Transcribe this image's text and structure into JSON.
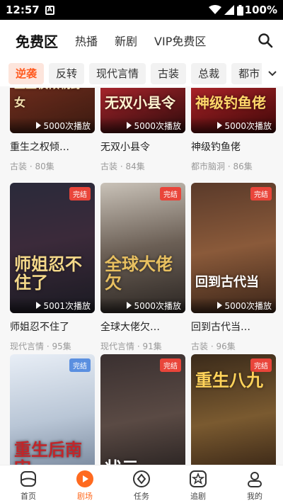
{
  "status": {
    "time": "12:57",
    "battery": "100%"
  },
  "header": {
    "tabs": [
      {
        "label": "免费区",
        "active": true
      },
      {
        "label": "热播"
      },
      {
        "label": "新剧"
      },
      {
        "label": "VIP免费区"
      }
    ]
  },
  "categories": [
    "逆袭",
    "反转",
    "现代言情",
    "古装",
    "总裁",
    "都市"
  ],
  "cards": [
    {
      "title": "重生之权倾…",
      "meta": "古装 · 80集",
      "plays": "5000次播放",
      "art": "重生权倾朝野女",
      "badge": ""
    },
    {
      "title": "无双小县令",
      "meta": "古装 · 84集",
      "plays": "5000次播放",
      "art": "无双小县令",
      "badge": ""
    },
    {
      "title": "神级钓鱼佬",
      "meta": "都市脑洞 · 86集",
      "plays": "5000次播放",
      "art": "神级钓鱼佬",
      "badge": ""
    },
    {
      "title": "师姐忍不住了",
      "meta": "现代言情 · 95集",
      "plays": "5001次播放",
      "art": "师姐忍不住了",
      "badge": "完结"
    },
    {
      "title": "全球大佬欠…",
      "meta": "现代言情 · 91集",
      "plays": "5000次播放",
      "art": "全球大佬欠",
      "badge": "完结"
    },
    {
      "title": "回到古代当…",
      "meta": "古装 · 96集",
      "plays": "5000次播放",
      "art": "回到古代当",
      "badge": "完结"
    },
    {
      "title": "",
      "meta": "",
      "plays": "",
      "art": "重生后南宋",
      "badge": "完结"
    },
    {
      "title": "",
      "meta": "",
      "plays": "",
      "art": "状元",
      "badge": "完结"
    },
    {
      "title": "",
      "meta": "",
      "plays": "",
      "art": "重生八九",
      "badge": "完结"
    }
  ],
  "tabbar": [
    {
      "label": "首页",
      "icon": "home-icon"
    },
    {
      "label": "剧场",
      "icon": "theater-icon",
      "active": true
    },
    {
      "label": "任务",
      "icon": "task-icon"
    },
    {
      "label": "追剧",
      "icon": "star-icon"
    },
    {
      "label": "我的",
      "icon": "profile-icon"
    }
  ],
  "colors": {
    "accent": "#ff6a1f",
    "badge_red": "#e9453a",
    "badge_blue": "#5a8fe0"
  }
}
